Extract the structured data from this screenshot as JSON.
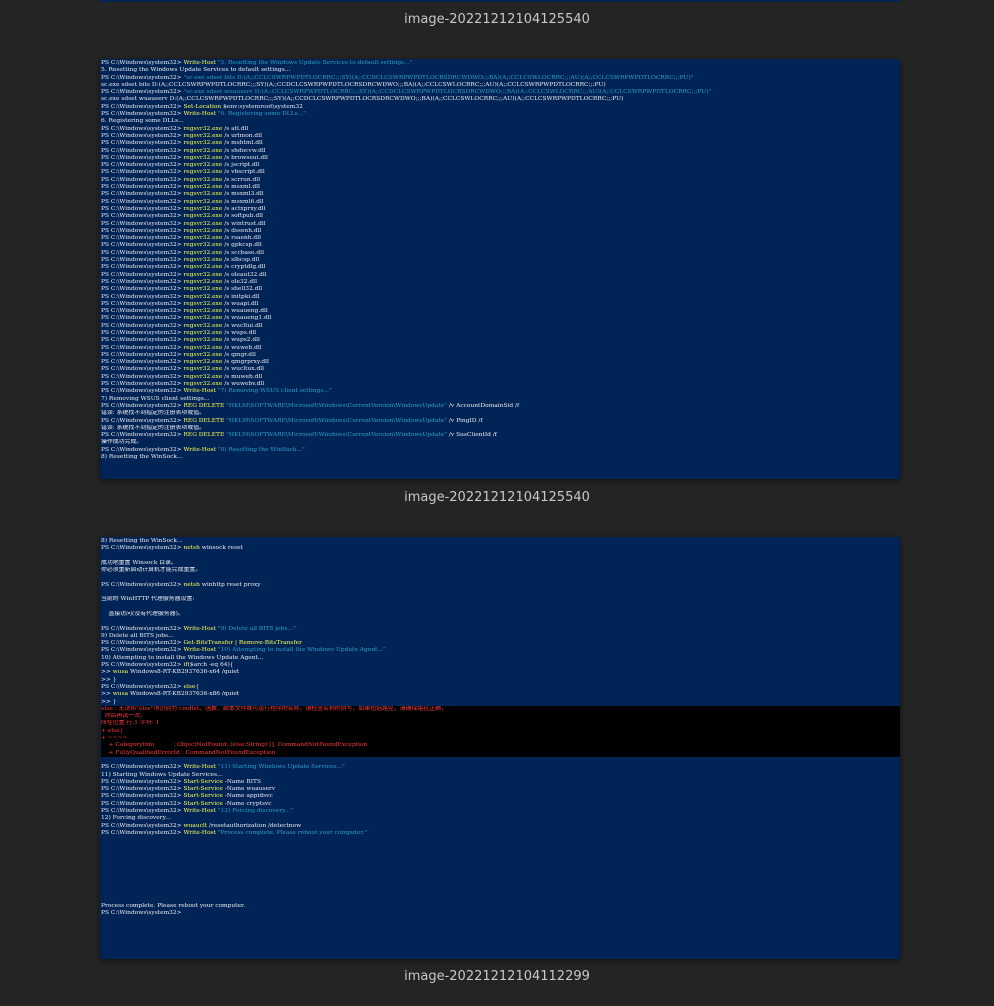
{
  "captions": {
    "first": "image-20221212104125540",
    "second": "image-20221212104125540",
    "third": "image-20221212104112299"
  },
  "colors": {
    "page_bg": "#242424",
    "terminal_bg": "#012456",
    "command": "#ffff55",
    "string": "#2aa0c8",
    "error_text": "#ff3b3b",
    "error_bg": "#000000"
  },
  "screenshot1": [
    {
      "t": "cmd",
      "p": "PS C:\\Windows\\system32> ",
      "c": "Write-Host",
      "s": " \"5. Resetting the Windows Update Services to default settings...\"",
      "a": ""
    },
    {
      "t": "out",
      "x": "5. Resetting the Windows Update Services to default settings..."
    },
    {
      "t": "cmd",
      "p": "PS C:\\Windows\\system32> ",
      "c": "",
      "s": "\"sc.exe sdset bits D:(A;;CCLCSWRPWPDTLOCRRC;;;SY)(A;;CCDCLCSWRPWPDTLOCRSDRCWDWO;;;BA)(A;;CCLCSWLOCRRC;;;AU)(A;;CCLCSWRPWPDTLOCRRC;;;PU)\"",
      "a": ""
    },
    {
      "t": "out",
      "x": "sc.exe sdset bits D:(A;;CCLCSWRPWPDTLOCRRC;;;SY)(A;;CCDCLCSWRPWPDTLOCRSDRCWDWO;;;BA)(A;;CCLCSWLOCRRC;;;AU)(A;;CCLCSWRPWPDTLOCRRC;;;PU)"
    },
    {
      "t": "cmd",
      "p": "PS C:\\Windows\\system32> ",
      "c": "",
      "s": "\"sc.exe sdset wuauserv D:(A;;CCLCSWRPWPDTLOCRRC;;;SY)(A;;CCDCLCSWRPWPDTLOCRSDRCWDWO;;;BA)(A;;CCLCSWLOCRRC;;;AU)(A;;CCLCSWRPWPDTLOCRRC;;;PU)\"",
      "a": ""
    },
    {
      "t": "out",
      "x": "sc.exe sdset wuauserv D:(A;;CCLCSWRPWPDTLOCRRC;;;SY)(A;;CCDCLCSWRPWPDTLOCRSDRCWDWO;;;BA)(A;;CCLCSWLOCRRC;;;AU)(A;;CCLCSWRPWPDTLOCRRC;;;PU)"
    },
    {
      "t": "cmd",
      "p": "PS C:\\Windows\\system32> ",
      "c": "Set-Location",
      "s": "",
      "a": " $env:systemroot\\system32"
    },
    {
      "t": "cmd",
      "p": "PS C:\\Windows\\system32> ",
      "c": "Write-Host",
      "s": " \"6. Registering some DLLs...\"",
      "a": ""
    },
    {
      "t": "out",
      "x": "6. Registering some DLLs..."
    },
    {
      "t": "cmd",
      "p": "PS C:\\Windows\\system32> ",
      "c": "regsvr32.exe",
      "s": "",
      "a": " /s atl.dll"
    },
    {
      "t": "cmd",
      "p": "PS C:\\Windows\\system32> ",
      "c": "regsvr32.exe",
      "s": "",
      "a": " /s urlmon.dll"
    },
    {
      "t": "cmd",
      "p": "PS C:\\Windows\\system32> ",
      "c": "regsvr32.exe",
      "s": "",
      "a": " /s mshtml.dll"
    },
    {
      "t": "cmd",
      "p": "PS C:\\Windows\\system32> ",
      "c": "regsvr32.exe",
      "s": "",
      "a": " /s shdocvw.dll"
    },
    {
      "t": "cmd",
      "p": "PS C:\\Windows\\system32> ",
      "c": "regsvr32.exe",
      "s": "",
      "a": " /s browseui.dll"
    },
    {
      "t": "cmd",
      "p": "PS C:\\Windows\\system32> ",
      "c": "regsvr32.exe",
      "s": "",
      "a": " /s jscript.dll"
    },
    {
      "t": "cmd",
      "p": "PS C:\\Windows\\system32> ",
      "c": "regsvr32.exe",
      "s": "",
      "a": " /s vbscript.dll"
    },
    {
      "t": "cmd",
      "p": "PS C:\\Windows\\system32> ",
      "c": "regsvr32.exe",
      "s": "",
      "a": " /s scrrun.dll"
    },
    {
      "t": "cmd",
      "p": "PS C:\\Windows\\system32> ",
      "c": "regsvr32.exe",
      "s": "",
      "a": " /s msxml.dll"
    },
    {
      "t": "cmd",
      "p": "PS C:\\Windows\\system32> ",
      "c": "regsvr32.exe",
      "s": "",
      "a": " /s msxml3.dll"
    },
    {
      "t": "cmd",
      "p": "PS C:\\Windows\\system32> ",
      "c": "regsvr32.exe",
      "s": "",
      "a": " /s msxml6.dll"
    },
    {
      "t": "cmd",
      "p": "PS C:\\Windows\\system32> ",
      "c": "regsvr32.exe",
      "s": "",
      "a": " /s actxprxy.dll"
    },
    {
      "t": "cmd",
      "p": "PS C:\\Windows\\system32> ",
      "c": "regsvr32.exe",
      "s": "",
      "a": " /s softpub.dll"
    },
    {
      "t": "cmd",
      "p": "PS C:\\Windows\\system32> ",
      "c": "regsvr32.exe",
      "s": "",
      "a": " /s wintrust.dll"
    },
    {
      "t": "cmd",
      "p": "PS C:\\Windows\\system32> ",
      "c": "regsvr32.exe",
      "s": "",
      "a": " /s dssenh.dll"
    },
    {
      "t": "cmd",
      "p": "PS C:\\Windows\\system32> ",
      "c": "regsvr32.exe",
      "s": "",
      "a": " /s rsaenh.dll"
    },
    {
      "t": "cmd",
      "p": "PS C:\\Windows\\system32> ",
      "c": "regsvr32.exe",
      "s": "",
      "a": " /s gpkcsp.dll"
    },
    {
      "t": "cmd",
      "p": "PS C:\\Windows\\system32> ",
      "c": "regsvr32.exe",
      "s": "",
      "a": " /s sccbase.dll"
    },
    {
      "t": "cmd",
      "p": "PS C:\\Windows\\system32> ",
      "c": "regsvr32.exe",
      "s": "",
      "a": " /s slbcsp.dll"
    },
    {
      "t": "cmd",
      "p": "PS C:\\Windows\\system32> ",
      "c": "regsvr32.exe",
      "s": "",
      "a": " /s cryptdlg.dll"
    },
    {
      "t": "cmd",
      "p": "PS C:\\Windows\\system32> ",
      "c": "regsvr32.exe",
      "s": "",
      "a": " /s oleaut32.dll"
    },
    {
      "t": "cmd",
      "p": "PS C:\\Windows\\system32> ",
      "c": "regsvr32.exe",
      "s": "",
      "a": " /s ole32.dll"
    },
    {
      "t": "cmd",
      "p": "PS C:\\Windows\\system32> ",
      "c": "regsvr32.exe",
      "s": "",
      "a": " /s shell32.dll"
    },
    {
      "t": "cmd",
      "p": "PS C:\\Windows\\system32> ",
      "c": "regsvr32.exe",
      "s": "",
      "a": " /s initpki.dll"
    },
    {
      "t": "cmd",
      "p": "PS C:\\Windows\\system32> ",
      "c": "regsvr32.exe",
      "s": "",
      "a": " /s wuapi.dll"
    },
    {
      "t": "cmd",
      "p": "PS C:\\Windows\\system32> ",
      "c": "regsvr32.exe",
      "s": "",
      "a": " /s wuaueng.dll"
    },
    {
      "t": "cmd",
      "p": "PS C:\\Windows\\system32> ",
      "c": "regsvr32.exe",
      "s": "",
      "a": " /s wuaueng1.dll"
    },
    {
      "t": "cmd",
      "p": "PS C:\\Windows\\system32> ",
      "c": "regsvr32.exe",
      "s": "",
      "a": " /s wucltui.dll"
    },
    {
      "t": "cmd",
      "p": "PS C:\\Windows\\system32> ",
      "c": "regsvr32.exe",
      "s": "",
      "a": " /s wups.dll"
    },
    {
      "t": "cmd",
      "p": "PS C:\\Windows\\system32> ",
      "c": "regsvr32.exe",
      "s": "",
      "a": " /s wups2.dll"
    },
    {
      "t": "cmd",
      "p": "PS C:\\Windows\\system32> ",
      "c": "regsvr32.exe",
      "s": "",
      "a": " /s wuweb.dll"
    },
    {
      "t": "cmd",
      "p": "PS C:\\Windows\\system32> ",
      "c": "regsvr32.exe",
      "s": "",
      "a": " /s qmgr.dll"
    },
    {
      "t": "cmd",
      "p": "PS C:\\Windows\\system32> ",
      "c": "regsvr32.exe",
      "s": "",
      "a": " /s qmgrprxy.dll"
    },
    {
      "t": "cmd",
      "p": "PS C:\\Windows\\system32> ",
      "c": "regsvr32.exe",
      "s": "",
      "a": " /s wucltux.dll"
    },
    {
      "t": "cmd",
      "p": "PS C:\\Windows\\system32> ",
      "c": "regsvr32.exe",
      "s": "",
      "a": " /s muweb.dll"
    },
    {
      "t": "cmd",
      "p": "PS C:\\Windows\\system32> ",
      "c": "regsvr32.exe",
      "s": "",
      "a": " /s wuwebv.dll"
    },
    {
      "t": "cmd",
      "p": "PS C:\\Windows\\system32> ",
      "c": "Write-Host",
      "s": " \"7) Removing WSUS client settings...\"",
      "a": ""
    },
    {
      "t": "out",
      "x": "7) Removing WSUS client settings..."
    },
    {
      "t": "cmd",
      "p": "PS C:\\Windows\\system32> ",
      "c": "REG DELETE",
      "s": " \"HKLM\\SOFTWARE\\Microsoft\\Windows\\CurrentVersion\\WindowsUpdate\"",
      "a": " /v AccountDomainSid /f"
    },
    {
      "t": "out",
      "x": "错误: 系统找不到指定的注册表项或值。"
    },
    {
      "t": "cmd",
      "p": "PS C:\\Windows\\system32> ",
      "c": "REG DELETE",
      "s": " \"HKLM\\SOFTWARE\\Microsoft\\Windows\\CurrentVersion\\WindowsUpdate\"",
      "a": " /v PingID /f"
    },
    {
      "t": "out",
      "x": "错误: 系统找不到指定的注册表项或值。"
    },
    {
      "t": "cmd",
      "p": "PS C:\\Windows\\system32> ",
      "c": "REG DELETE",
      "s": " \"HKLM\\SOFTWARE\\Microsoft\\Windows\\CurrentVersion\\WindowsUpdate\"",
      "a": " /v SusClientId /f"
    },
    {
      "t": "out",
      "x": "操作成功完成。"
    },
    {
      "t": "cmd",
      "p": "PS C:\\Windows\\system32> ",
      "c": "Write-Host",
      "s": " \"8) Resetting the WinSock...\"",
      "a": ""
    },
    {
      "t": "out",
      "x": "8) Resetting the WinSock..."
    }
  ],
  "screenshot2": [
    {
      "t": "out",
      "x": "8) Resetting the WinSock..."
    },
    {
      "t": "cmd",
      "p": "PS C:\\Windows\\system32> ",
      "c": "netsh",
      "s": "",
      "a": " winsock reset"
    },
    {
      "t": "blank"
    },
    {
      "t": "out",
      "x": "成功地重置 Winsock 目录。"
    },
    {
      "t": "out",
      "x": "你必须重新启动计算机才能完成重置。"
    },
    {
      "t": "blank"
    },
    {
      "t": "cmd",
      "p": "PS C:\\Windows\\system32> ",
      "c": "netsh",
      "s": "",
      "a": " winhttp reset proxy"
    },
    {
      "t": "blank"
    },
    {
      "t": "out",
      "x": "当前的 WinHTTP 代理服务器设置:"
    },
    {
      "t": "blank"
    },
    {
      "t": "out",
      "x": "    直接访问(没有代理服务器)。"
    },
    {
      "t": "blank"
    },
    {
      "t": "cmd",
      "p": "PS C:\\Windows\\system32> ",
      "c": "Write-Host",
      "s": " \"9) Delete all BITS jobs...\"",
      "a": ""
    },
    {
      "t": "out",
      "x": "9) Delete all BITS jobs..."
    },
    {
      "t": "cmd",
      "p": "PS C:\\Windows\\system32> ",
      "c": "Get-BitsTransfer | Remove-BitsTransfer",
      "s": "",
      "a": ""
    },
    {
      "t": "cmd",
      "p": "PS C:\\Windows\\system32> ",
      "c": "Write-Host",
      "s": " \"10) Attempting to install the Windows Update Agent...\"",
      "a": ""
    },
    {
      "t": "out",
      "x": "10) Attempting to install the Windows Update Agent..."
    },
    {
      "t": "cmd",
      "p": "PS C:\\Windows\\system32> ",
      "c": "if",
      "s": "",
      "a": "($arch -eq 64){"
    },
    {
      "t": "cmd",
      "p": ">> ",
      "c": "wusa",
      "s": "",
      "a": " Windows8-RT-KB2937636-x64 /quiet"
    },
    {
      "t": "out",
      "x": ">> }"
    },
    {
      "t": "cmd",
      "p": "PS C:\\Windows\\system32> ",
      "c": "else",
      "s": "",
      "a": "{"
    },
    {
      "t": "cmd",
      "p": ">> ",
      "c": "wusa",
      "s": "",
      "a": " Windows8-RT-KB2937636-x86 /quiet"
    },
    {
      "t": "out",
      "x": ">> }"
    },
    {
      "t": "err",
      "lines": [
        "else : 无法将\"else\"项识别为 cmdlet、函数、脚本文件或可运行程序的名称。请检查名称的拼写，如果包括路径，请确保路径正确，",
        "  然后再试一次。",
        "所在位置 行:1 字符: 1",
        "+ else{",
        "+ ~~~~",
        "    + CategoryInfo          : ObjectNotFound: (else:String) [], CommandNotFoundException",
        "    + FullyQualifiedErrorId : CommandNotFoundException"
      ]
    },
    {
      "t": "blank"
    },
    {
      "t": "cmd",
      "p": "PS C:\\Windows\\system32> ",
      "c": "Write-Host",
      "s": " \"11) Starting Windows Update Services...\"",
      "a": ""
    },
    {
      "t": "out",
      "x": "11) Starting Windows Update Services..."
    },
    {
      "t": "cmd",
      "p": "PS C:\\Windows\\system32> ",
      "c": "Start-Service",
      "s": "",
      "a": " -Name BITS"
    },
    {
      "t": "cmd",
      "p": "PS C:\\Windows\\system32> ",
      "c": "Start-Service",
      "s": "",
      "a": " -Name wuauserv"
    },
    {
      "t": "cmd",
      "p": "PS C:\\Windows\\system32> ",
      "c": "Start-Service",
      "s": "",
      "a": " -Name appidsvc"
    },
    {
      "t": "cmd",
      "p": "PS C:\\Windows\\system32> ",
      "c": "Start-Service",
      "s": "",
      "a": " -Name cryptsvc"
    },
    {
      "t": "cmd",
      "p": "PS C:\\Windows\\system32> ",
      "c": "Write-Host",
      "s": " \"12) Forcing discovery...\"",
      "a": ""
    },
    {
      "t": "out",
      "x": "12) Forcing discovery..."
    },
    {
      "t": "cmd",
      "p": "PS C:\\Windows\\system32> ",
      "c": "wuauclt",
      "s": "",
      "a": " /resetauthorization /detectnow"
    },
    {
      "t": "cmd",
      "p": "PS C:\\Windows\\system32> ",
      "c": "Write-Host",
      "s": " \"Process complete. Please reboot your computer.\"",
      "a": ""
    },
    {
      "t": "blank"
    },
    {
      "t": "blank"
    },
    {
      "t": "blank"
    },
    {
      "t": "blank"
    },
    {
      "t": "blank"
    },
    {
      "t": "blank"
    },
    {
      "t": "blank"
    },
    {
      "t": "blank"
    },
    {
      "t": "blank"
    },
    {
      "t": "out",
      "x": "Process complete. Please reboot your computer."
    },
    {
      "t": "out",
      "x": "PS C:\\Windows\\system32>"
    }
  ]
}
